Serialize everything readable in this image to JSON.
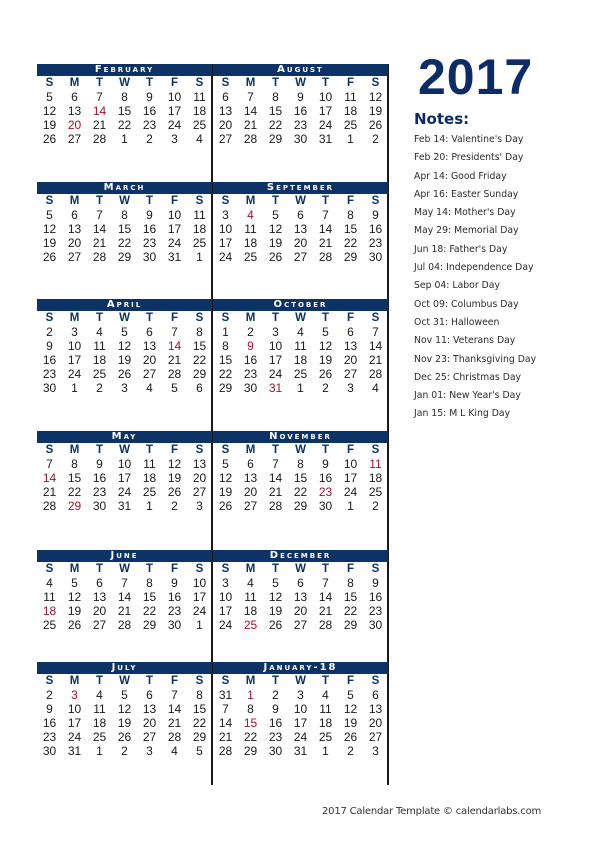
{
  "year": "2017",
  "colors": {
    "header_bg": "#0d3366",
    "holiday": "#a3132e",
    "title": "#0d2c66"
  },
  "weekday_labels": [
    "S",
    "M",
    "T",
    "W",
    "T",
    "F",
    "S"
  ],
  "left_months": [
    {
      "name": "February",
      "weeks": [
        [
          {
            "d": "5"
          },
          {
            "d": "6"
          },
          {
            "d": "7"
          },
          {
            "d": "8"
          },
          {
            "d": "9"
          },
          {
            "d": "10"
          },
          {
            "d": "11"
          }
        ],
        [
          {
            "d": "12"
          },
          {
            "d": "13"
          },
          {
            "d": "14",
            "h": true
          },
          {
            "d": "15"
          },
          {
            "d": "16"
          },
          {
            "d": "17"
          },
          {
            "d": "18"
          }
        ],
        [
          {
            "d": "19"
          },
          {
            "d": "20",
            "h": true
          },
          {
            "d": "21"
          },
          {
            "d": "22"
          },
          {
            "d": "23"
          },
          {
            "d": "24"
          },
          {
            "d": "25"
          }
        ],
        [
          {
            "d": "26"
          },
          {
            "d": "27"
          },
          {
            "d": "28"
          },
          {
            "d": "1"
          },
          {
            "d": "2"
          },
          {
            "d": "3"
          },
          {
            "d": "4"
          }
        ]
      ]
    },
    {
      "name": "March",
      "weeks": [
        [
          {
            "d": "5"
          },
          {
            "d": "6"
          },
          {
            "d": "7"
          },
          {
            "d": "8"
          },
          {
            "d": "9"
          },
          {
            "d": "10"
          },
          {
            "d": "11"
          }
        ],
        [
          {
            "d": "12"
          },
          {
            "d": "13"
          },
          {
            "d": "14"
          },
          {
            "d": "15"
          },
          {
            "d": "16"
          },
          {
            "d": "17"
          },
          {
            "d": "18"
          }
        ],
        [
          {
            "d": "19"
          },
          {
            "d": "20"
          },
          {
            "d": "21"
          },
          {
            "d": "22"
          },
          {
            "d": "23"
          },
          {
            "d": "24"
          },
          {
            "d": "25"
          }
        ],
        [
          {
            "d": "26"
          },
          {
            "d": "27"
          },
          {
            "d": "28"
          },
          {
            "d": "29"
          },
          {
            "d": "30"
          },
          {
            "d": "31"
          },
          {
            "d": "1"
          }
        ]
      ]
    },
    {
      "name": "April",
      "weeks": [
        [
          {
            "d": "2"
          },
          {
            "d": "3"
          },
          {
            "d": "4"
          },
          {
            "d": "5"
          },
          {
            "d": "6"
          },
          {
            "d": "7"
          },
          {
            "d": "8"
          }
        ],
        [
          {
            "d": "9"
          },
          {
            "d": "10"
          },
          {
            "d": "11"
          },
          {
            "d": "12"
          },
          {
            "d": "13"
          },
          {
            "d": "14",
            "h": true
          },
          {
            "d": "15"
          }
        ],
        [
          {
            "d": "16"
          },
          {
            "d": "17"
          },
          {
            "d": "18"
          },
          {
            "d": "19"
          },
          {
            "d": "20"
          },
          {
            "d": "21"
          },
          {
            "d": "22"
          }
        ],
        [
          {
            "d": "23"
          },
          {
            "d": "24"
          },
          {
            "d": "25"
          },
          {
            "d": "26"
          },
          {
            "d": "27"
          },
          {
            "d": "28"
          },
          {
            "d": "29"
          }
        ],
        [
          {
            "d": "30"
          },
          {
            "d": "1"
          },
          {
            "d": "2"
          },
          {
            "d": "3"
          },
          {
            "d": "4"
          },
          {
            "d": "5"
          },
          {
            "d": "6"
          }
        ]
      ]
    },
    {
      "name": "May",
      "weeks": [
        [
          {
            "d": "7"
          },
          {
            "d": "8"
          },
          {
            "d": "9"
          },
          {
            "d": "10"
          },
          {
            "d": "11"
          },
          {
            "d": "12"
          },
          {
            "d": "13"
          }
        ],
        [
          {
            "d": "14",
            "h": true
          },
          {
            "d": "15"
          },
          {
            "d": "16"
          },
          {
            "d": "17"
          },
          {
            "d": "18"
          },
          {
            "d": "19"
          },
          {
            "d": "20"
          }
        ],
        [
          {
            "d": "21"
          },
          {
            "d": "22"
          },
          {
            "d": "23"
          },
          {
            "d": "24"
          },
          {
            "d": "25"
          },
          {
            "d": "26"
          },
          {
            "d": "27"
          }
        ],
        [
          {
            "d": "28"
          },
          {
            "d": "29",
            "h": true
          },
          {
            "d": "30"
          },
          {
            "d": "31"
          },
          {
            "d": "1"
          },
          {
            "d": "2"
          },
          {
            "d": "3"
          }
        ]
      ]
    },
    {
      "name": "June",
      "weeks": [
        [
          {
            "d": "4"
          },
          {
            "d": "5"
          },
          {
            "d": "6"
          },
          {
            "d": "7"
          },
          {
            "d": "8"
          },
          {
            "d": "9"
          },
          {
            "d": "10"
          }
        ],
        [
          {
            "d": "11"
          },
          {
            "d": "12"
          },
          {
            "d": "13"
          },
          {
            "d": "14"
          },
          {
            "d": "15"
          },
          {
            "d": "16"
          },
          {
            "d": "17"
          }
        ],
        [
          {
            "d": "18",
            "h": true
          },
          {
            "d": "19"
          },
          {
            "d": "20"
          },
          {
            "d": "21"
          },
          {
            "d": "22"
          },
          {
            "d": "23"
          },
          {
            "d": "24"
          }
        ],
        [
          {
            "d": "25"
          },
          {
            "d": "26"
          },
          {
            "d": "27"
          },
          {
            "d": "28"
          },
          {
            "d": "29"
          },
          {
            "d": "30"
          },
          {
            "d": "1"
          }
        ]
      ]
    },
    {
      "name": "July",
      "weeks": [
        [
          {
            "d": "2"
          },
          {
            "d": "3",
            "h": true
          },
          {
            "d": "4"
          },
          {
            "d": "5"
          },
          {
            "d": "6"
          },
          {
            "d": "7"
          },
          {
            "d": "8"
          }
        ],
        [
          {
            "d": "9"
          },
          {
            "d": "10"
          },
          {
            "d": "11"
          },
          {
            "d": "12"
          },
          {
            "d": "13"
          },
          {
            "d": "14"
          },
          {
            "d": "15"
          }
        ],
        [
          {
            "d": "16"
          },
          {
            "d": "17"
          },
          {
            "d": "18"
          },
          {
            "d": "19"
          },
          {
            "d": "20"
          },
          {
            "d": "21"
          },
          {
            "d": "22"
          }
        ],
        [
          {
            "d": "23"
          },
          {
            "d": "24"
          },
          {
            "d": "25"
          },
          {
            "d": "26"
          },
          {
            "d": "27"
          },
          {
            "d": "28"
          },
          {
            "d": "29"
          }
        ],
        [
          {
            "d": "30"
          },
          {
            "d": "31"
          },
          {
            "d": "1"
          },
          {
            "d": "2"
          },
          {
            "d": "3"
          },
          {
            "d": "4"
          },
          {
            "d": "5"
          }
        ]
      ]
    }
  ],
  "right_months": [
    {
      "name": "August",
      "weeks": [
        [
          {
            "d": "6"
          },
          {
            "d": "7"
          },
          {
            "d": "8"
          },
          {
            "d": "9"
          },
          {
            "d": "10"
          },
          {
            "d": "11"
          },
          {
            "d": "12"
          }
        ],
        [
          {
            "d": "13"
          },
          {
            "d": "14"
          },
          {
            "d": "15"
          },
          {
            "d": "16"
          },
          {
            "d": "17"
          },
          {
            "d": "18"
          },
          {
            "d": "19"
          }
        ],
        [
          {
            "d": "20"
          },
          {
            "d": "21"
          },
          {
            "d": "22"
          },
          {
            "d": "23"
          },
          {
            "d": "24"
          },
          {
            "d": "25"
          },
          {
            "d": "26"
          }
        ],
        [
          {
            "d": "27"
          },
          {
            "d": "28"
          },
          {
            "d": "29"
          },
          {
            "d": "30"
          },
          {
            "d": "31"
          },
          {
            "d": "1"
          },
          {
            "d": "2"
          }
        ]
      ]
    },
    {
      "name": "September",
      "weeks": [
        [
          {
            "d": "3"
          },
          {
            "d": "4",
            "h": true
          },
          {
            "d": "5"
          },
          {
            "d": "6"
          },
          {
            "d": "7"
          },
          {
            "d": "8"
          },
          {
            "d": "9"
          }
        ],
        [
          {
            "d": "10"
          },
          {
            "d": "11"
          },
          {
            "d": "12"
          },
          {
            "d": "13"
          },
          {
            "d": "14"
          },
          {
            "d": "15"
          },
          {
            "d": "16"
          }
        ],
        [
          {
            "d": "17"
          },
          {
            "d": "18"
          },
          {
            "d": "19"
          },
          {
            "d": "20"
          },
          {
            "d": "21"
          },
          {
            "d": "22"
          },
          {
            "d": "23"
          }
        ],
        [
          {
            "d": "24"
          },
          {
            "d": "25"
          },
          {
            "d": "26"
          },
          {
            "d": "27"
          },
          {
            "d": "28"
          },
          {
            "d": "29"
          },
          {
            "d": "30"
          }
        ]
      ]
    },
    {
      "name": "October",
      "weeks": [
        [
          {
            "d": "1"
          },
          {
            "d": "2"
          },
          {
            "d": "3"
          },
          {
            "d": "4"
          },
          {
            "d": "5"
          },
          {
            "d": "6"
          },
          {
            "d": "7"
          }
        ],
        [
          {
            "d": "8"
          },
          {
            "d": "9",
            "h": true
          },
          {
            "d": "10"
          },
          {
            "d": "11"
          },
          {
            "d": "12"
          },
          {
            "d": "13"
          },
          {
            "d": "14"
          }
        ],
        [
          {
            "d": "15"
          },
          {
            "d": "16"
          },
          {
            "d": "17"
          },
          {
            "d": "18"
          },
          {
            "d": "19"
          },
          {
            "d": "20"
          },
          {
            "d": "21"
          }
        ],
        [
          {
            "d": "22"
          },
          {
            "d": "23"
          },
          {
            "d": "24"
          },
          {
            "d": "25"
          },
          {
            "d": "26"
          },
          {
            "d": "27"
          },
          {
            "d": "28"
          }
        ],
        [
          {
            "d": "29"
          },
          {
            "d": "30"
          },
          {
            "d": "31",
            "h": true
          },
          {
            "d": "1"
          },
          {
            "d": "2"
          },
          {
            "d": "3"
          },
          {
            "d": "4"
          }
        ]
      ]
    },
    {
      "name": "November",
      "weeks": [
        [
          {
            "d": "5"
          },
          {
            "d": "6"
          },
          {
            "d": "7"
          },
          {
            "d": "8"
          },
          {
            "d": "9"
          },
          {
            "d": "10"
          },
          {
            "d": "11",
            "h": true
          }
        ],
        [
          {
            "d": "12"
          },
          {
            "d": "13"
          },
          {
            "d": "14"
          },
          {
            "d": "15"
          },
          {
            "d": "16"
          },
          {
            "d": "17"
          },
          {
            "d": "18"
          }
        ],
        [
          {
            "d": "19"
          },
          {
            "d": "20"
          },
          {
            "d": "21"
          },
          {
            "d": "22"
          },
          {
            "d": "23",
            "h": true
          },
          {
            "d": "24"
          },
          {
            "d": "25"
          }
        ],
        [
          {
            "d": "26"
          },
          {
            "d": "27"
          },
          {
            "d": "28"
          },
          {
            "d": "29"
          },
          {
            "d": "30"
          },
          {
            "d": "1"
          },
          {
            "d": "2"
          }
        ]
      ]
    },
    {
      "name": "December",
      "weeks": [
        [
          {
            "d": "3"
          },
          {
            "d": "4"
          },
          {
            "d": "5"
          },
          {
            "d": "6"
          },
          {
            "d": "7"
          },
          {
            "d": "8"
          },
          {
            "d": "9"
          }
        ],
        [
          {
            "d": "10"
          },
          {
            "d": "11"
          },
          {
            "d": "12"
          },
          {
            "d": "13"
          },
          {
            "d": "14"
          },
          {
            "d": "15"
          },
          {
            "d": "16"
          }
        ],
        [
          {
            "d": "17"
          },
          {
            "d": "18"
          },
          {
            "d": "19"
          },
          {
            "d": "20"
          },
          {
            "d": "21"
          },
          {
            "d": "22"
          },
          {
            "d": "23"
          }
        ],
        [
          {
            "d": "24"
          },
          {
            "d": "25",
            "h": true
          },
          {
            "d": "26"
          },
          {
            "d": "27"
          },
          {
            "d": "28"
          },
          {
            "d": "29"
          },
          {
            "d": "30"
          }
        ]
      ]
    },
    {
      "name": "January-18",
      "weeks": [
        [
          {
            "d": "31"
          },
          {
            "d": "1",
            "h": true
          },
          {
            "d": "2"
          },
          {
            "d": "3"
          },
          {
            "d": "4"
          },
          {
            "d": "5"
          },
          {
            "d": "6"
          }
        ],
        [
          {
            "d": "7"
          },
          {
            "d": "8"
          },
          {
            "d": "9"
          },
          {
            "d": "10"
          },
          {
            "d": "11"
          },
          {
            "d": "12"
          },
          {
            "d": "13"
          }
        ],
        [
          {
            "d": "14"
          },
          {
            "d": "15",
            "h": true
          },
          {
            "d": "16"
          },
          {
            "d": "17"
          },
          {
            "d": "18"
          },
          {
            "d": "19"
          },
          {
            "d": "20"
          }
        ],
        [
          {
            "d": "21"
          },
          {
            "d": "22"
          },
          {
            "d": "23"
          },
          {
            "d": "24"
          },
          {
            "d": "25"
          },
          {
            "d": "26"
          },
          {
            "d": "27"
          }
        ],
        [
          {
            "d": "28"
          },
          {
            "d": "29"
          },
          {
            "d": "30"
          },
          {
            "d": "31"
          },
          {
            "d": "1"
          },
          {
            "d": "2"
          },
          {
            "d": "3"
          }
        ]
      ]
    }
  ],
  "notes": {
    "title": "Notes:",
    "items": [
      "Feb 14: Valentine's Day",
      "Feb 20: Presidents' Day",
      "Apr 14: Good Friday",
      "Apr 16: Easter Sunday",
      "May 14: Mother's Day",
      "May 29: Memorial Day",
      "Jun 18: Father's Day",
      "Jul 04: Independence Day",
      "Sep 04: Labor Day",
      "Oct 09: Columbus Day",
      "Oct 31: Halloween",
      "Nov 11: Veterans Day",
      "Nov 23: Thanksgiving Day",
      "Dec 25: Christmas Day",
      "Jan 01: New Year's Day",
      "Jan 15: M L King Day"
    ]
  },
  "footer": "2017 Calendar Template © calendarlabs.com"
}
